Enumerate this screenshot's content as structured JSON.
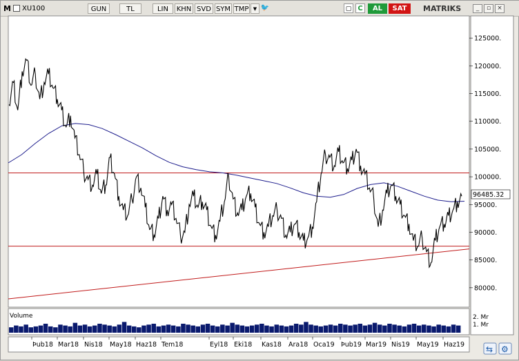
{
  "toolbar": {
    "logo": "M",
    "symbol": "XU100",
    "period": "GUN",
    "currency": "TL",
    "scale": "LIN",
    "khn": "KHN",
    "svd": "SVD",
    "sym": "SYM",
    "tmp": "TMP",
    "buy": "AL",
    "sell": "SAT",
    "brand": "MATRIKS",
    "colors": {
      "buy": "#1f9a3a",
      "sell": "#d21414"
    }
  },
  "chart_data": {
    "type": "line",
    "price_axis": {
      "ticks": [
        "125000.",
        "120000.",
        "115000.",
        "110000.",
        "105000.",
        "100000.",
        "95000.",
        "90000.",
        "85000.",
        "80000."
      ],
      "range": [
        76500,
        129000
      ]
    },
    "last_value_label": "96485.32",
    "volume_label": "Volume",
    "volume_ticks": [
      "2. Mr",
      "1. Mr"
    ],
    "x_ticks": [
      "Þub18",
      "Mar18",
      "Nis18",
      "May18",
      "Haz18",
      "Tem18",
      "Eyl18",
      "Eki18",
      "Kas18",
      "Ara18",
      "Oca19",
      "Þub19",
      "Mar19",
      "Nis19",
      "May19",
      "Haz19"
    ],
    "horizontal_lines": [
      100700,
      87500
    ],
    "trendline": {
      "from": 78000,
      "to": 87000
    },
    "price_series": [
      113000,
      117000,
      112000,
      119000,
      121000,
      116500,
      118500,
      114000,
      117000,
      118500,
      116000,
      114000,
      112000,
      109000,
      111000,
      107000,
      104000,
      101000,
      99500,
      98500,
      100500,
      97000,
      98500,
      103500,
      100500,
      96500,
      94000,
      93000,
      96000,
      100000,
      98000,
      94500,
      90500,
      89500,
      92500,
      96500,
      94000,
      95000,
      92500,
      89500,
      90000,
      95000,
      96500,
      94500,
      95500,
      94000,
      91000,
      89500,
      92000,
      95500,
      100000,
      96000,
      93500,
      94000,
      96500,
      97000,
      94500,
      91500,
      90000,
      91000,
      93000,
      94000,
      92500,
      89500,
      90000,
      91500,
      90000,
      88500,
      89000,
      91000,
      95500,
      100500,
      104000,
      103500,
      102000,
      104500,
      102500,
      101500,
      103000,
      105000,
      102000,
      100500,
      98000,
      96000,
      91000,
      94000,
      97000,
      98500,
      96500,
      95000,
      93000,
      91500,
      88500,
      87500,
      89000,
      86500,
      84500,
      88500,
      91000,
      91500,
      93000,
      94000,
      95500,
      96500
    ],
    "moving_average": [
      102500,
      104000,
      106000,
      107800,
      109200,
      109600,
      109400,
      108700,
      107600,
      106400,
      105200,
      103800,
      102600,
      101800,
      101300,
      100900,
      100700,
      100300,
      99800,
      99300,
      98800,
      98000,
      97100,
      96500,
      96300,
      96800,
      97900,
      98600,
      98900,
      98300,
      97400,
      96500,
      95800,
      95500,
      95600
    ],
    "volume": [
      0.6,
      0.8,
      0.7,
      0.9,
      0.6,
      0.7,
      0.8,
      1.0,
      0.7,
      0.6,
      0.9,
      0.8,
      0.7,
      1.1,
      0.8,
      0.9,
      0.7,
      0.8,
      1.0,
      0.9,
      0.8,
      0.7,
      0.9,
      1.2,
      0.8,
      0.7,
      0.6,
      0.8,
      0.9,
      1.0,
      0.7,
      0.8,
      0.9,
      0.8,
      0.7,
      1.0,
      0.9,
      0.8,
      0.7,
      0.9,
      1.0,
      0.8,
      0.7,
      0.9,
      0.8,
      1.1,
      0.9,
      0.8,
      0.7,
      0.8,
      0.9,
      1.0,
      0.8,
      0.7,
      0.9,
      0.8,
      0.7,
      0.8,
      1.0,
      0.9,
      1.2,
      0.9,
      0.8,
      0.7,
      0.8,
      0.9,
      0.8,
      1.0,
      0.9,
      0.8,
      0.9,
      1.0,
      0.8,
      0.9,
      1.1,
      0.9,
      0.8,
      1.0,
      0.9,
      0.8,
      0.7,
      0.9,
      1.0,
      0.8,
      0.9,
      0.8,
      0.7,
      0.9,
      0.8,
      0.7,
      0.9,
      0.8
    ],
    "colors": {
      "price": "#000000",
      "ma": "#1c1c8c",
      "hline": "#c01818",
      "trend": "#c01818",
      "volume": "#0a1a6e"
    }
  }
}
